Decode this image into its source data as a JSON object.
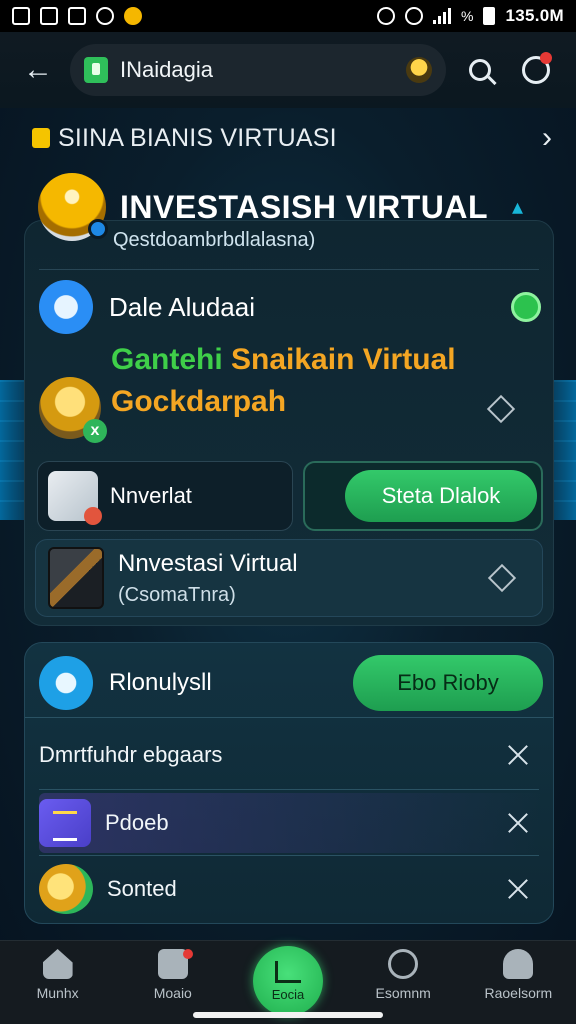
{
  "status_bar": {
    "time": "135.0M",
    "battery_text": "%"
  },
  "browser": {
    "url_text": "INaidagia"
  },
  "section": {
    "title": "SIINA BIANIS VIRTUASI"
  },
  "hero": {
    "title": "INVESTASISH VIRTUAL",
    "subtitle": "Qestdoambrbdlalasna)"
  },
  "main_card": {
    "row1": {
      "label": "Dale Aludaai"
    },
    "gain": {
      "line1_green": "Gantehi ",
      "line1_yellow": "Snaikain Virtual",
      "line2": "Gockdarpah"
    },
    "tile_left": {
      "label": "Nnverlat"
    },
    "tile_right": {
      "button": "Steta Dlalok"
    },
    "row_nv": {
      "title": "Nnvestasi Virtual",
      "subtitle": "(CsomaTnra)"
    }
  },
  "second_card": {
    "header": {
      "label": "Rlonulysll",
      "button": "Ebo Rioby"
    },
    "rows": [
      {
        "label": "Dmrtfuhdr ebgaars"
      },
      {
        "label": "Pdoeb"
      },
      {
        "label": "Sonted"
      }
    ]
  },
  "bottom_nav": {
    "items": [
      {
        "label": "Munhx"
      },
      {
        "label": "Moaio"
      },
      {
        "label": "Eocia"
      },
      {
        "label": "Esomnm"
      },
      {
        "label": "Raoelsorm"
      }
    ]
  },
  "colors": {
    "accent_green": "#2fbf5a",
    "gold": "#f4a623",
    "highlight_green": "#3fcf49",
    "background": "#0a1e2c"
  }
}
